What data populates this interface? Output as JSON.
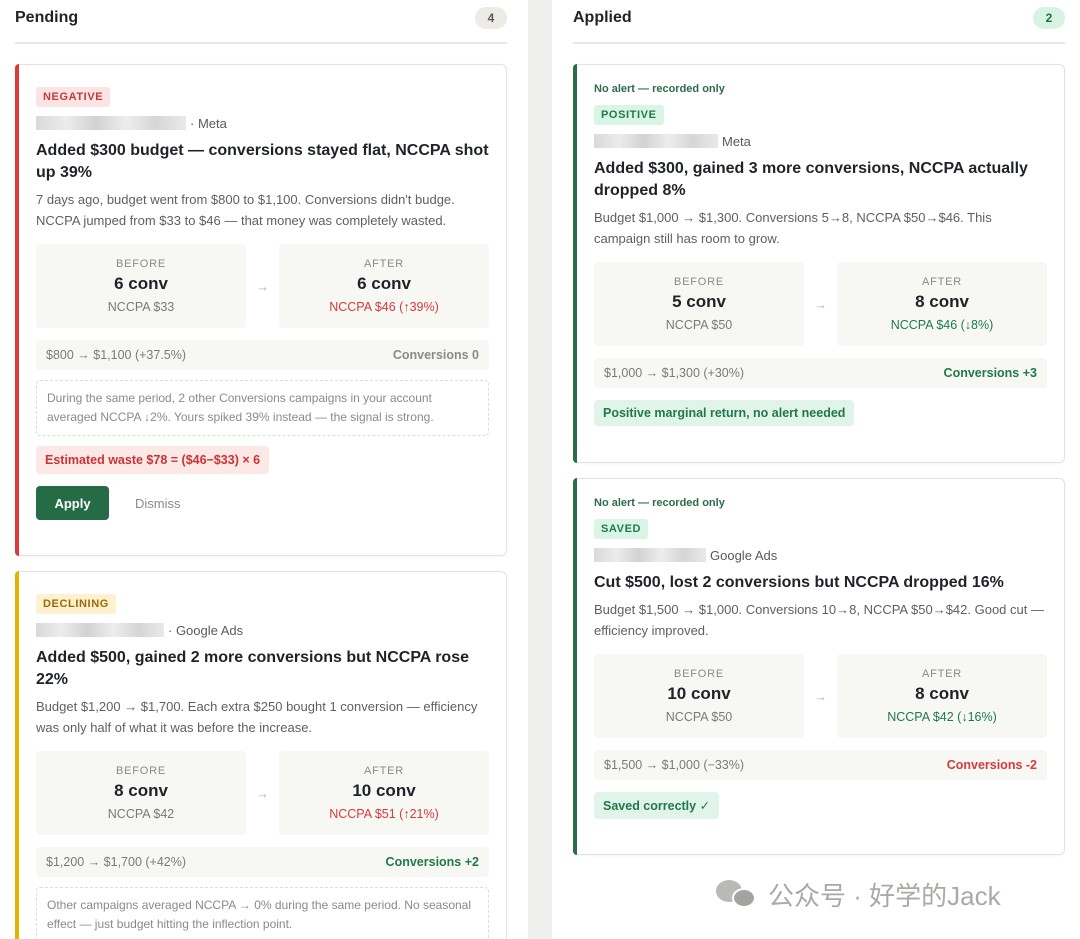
{
  "pending": {
    "title": "Pending",
    "count": "4",
    "cards": [
      {
        "badge": "NEGATIVE",
        "source": "· Meta",
        "title": "Added $300 budget — conversions stayed flat, NCCPA shot up 39%",
        "desc": "7 days ago, budget went from $800 to $1,100. Conversions didn't budge. NCCPA jumped from $33 to $46 — that money was completely wasted.",
        "before": {
          "label": "BEFORE",
          "value": "6 conv",
          "sub": "NCCPA $33"
        },
        "after": {
          "label": "AFTER",
          "value": "6 conv",
          "sub": "NCCPA $46 (↑39%)"
        },
        "arrow": "→",
        "summary_left": "$800 → $1,100 (+37.5%)",
        "summary_right": "Conversions 0",
        "note": "During the same period, 2 other Conversions campaigns in your account averaged NCCPA ↓2%. Yours spiked 39% instead — the signal is strong.",
        "waste": "Estimated waste $78 = ($46−$33) × 6",
        "apply": "Apply",
        "dismiss": "Dismiss"
      },
      {
        "badge": "DECLINING",
        "source": "· Google Ads",
        "title": "Added $500, gained 2 more conversions but NCCPA rose 22%",
        "desc": "Budget $1,200 → $1,700. Each extra $250 bought 1 conversion — efficiency was only half of what it was before the increase.",
        "before": {
          "label": "BEFORE",
          "value": "8 conv",
          "sub": "NCCPA $42"
        },
        "after": {
          "label": "AFTER",
          "value": "10 conv",
          "sub": "NCCPA $51 (↑21%)"
        },
        "arrow": "→",
        "summary_left": "$1,200 → $1,700 (+42%)",
        "summary_right": "Conversions +2",
        "note": "Other campaigns averaged NCCPA → 0% during the same period. No seasonal effect — just budget hitting the inflection point."
      }
    ]
  },
  "applied": {
    "title": "Applied",
    "count": "2",
    "cards": [
      {
        "noalert": "No alert — recorded only",
        "badge": "POSITIVE",
        "source": "Meta",
        "title": "Added $300, gained 3 more conversions, NCCPA actually dropped 8%",
        "desc": "Budget $1,000 → $1,300. Conversions 5→8, NCCPA $50→$46. This campaign still has room to grow.",
        "before": {
          "label": "BEFORE",
          "value": "5 conv",
          "sub": "NCCPA $50"
        },
        "after": {
          "label": "AFTER",
          "value": "8 conv",
          "sub": "NCCPA $46 (↓8%)"
        },
        "arrow": "→",
        "summary_left": "$1,000 → $1,300 (+30%)",
        "summary_right": "Conversions +3",
        "chip": "Positive marginal return, no alert needed"
      },
      {
        "noalert": "No alert — recorded only",
        "badge": "SAVED",
        "source": "Google Ads",
        "title": "Cut $500, lost 2 conversions but NCCPA dropped 16%",
        "desc": "Budget $1,500 → $1,000. Conversions 10→8, NCCPA $50→$42. Good cut — efficiency improved.",
        "before": {
          "label": "BEFORE",
          "value": "10 conv",
          "sub": "NCCPA $50"
        },
        "after": {
          "label": "AFTER",
          "value": "8 conv",
          "sub": "NCCPA $42 (↓16%)"
        },
        "arrow": "→",
        "summary_left": "$1,500 → $1,000 (−33%)",
        "summary_right": "Conversions -2",
        "chip": "Saved correctly ✓"
      }
    ]
  },
  "watermark": "公众号 · 好学的Jack",
  "colors": {
    "negative": "#dc3a3a",
    "declining": "#e0b400",
    "positive": "#2d6b4a",
    "apply_button": "#256b45"
  }
}
